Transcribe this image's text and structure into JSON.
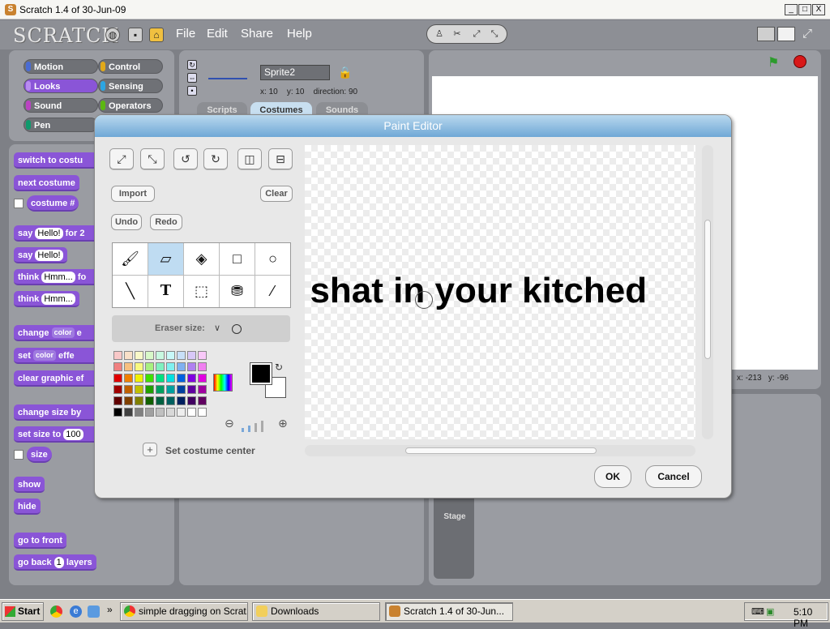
{
  "window": {
    "title": "Scratch 1.4 of 30-Jun-09",
    "app_icon": "scratch-cat-icon",
    "min_label": "_",
    "max_label": "□",
    "close_label": "X"
  },
  "menubar": {
    "logo": "SCRATCH",
    "icons": [
      "globe-icon",
      "save-icon",
      "share-icon"
    ],
    "items": [
      "File",
      "Edit",
      "Share",
      "Help"
    ]
  },
  "categories": {
    "motion": "Motion",
    "looks": "Looks",
    "sound": "Sound",
    "pen": "Pen",
    "control": "Control",
    "sensing": "Sensing",
    "operators": "Operators",
    "variables": ""
  },
  "blocks": {
    "switch_costume": "switch to costu",
    "next_costume": "next costume",
    "costume_num": "costume #",
    "say_for": "say",
    "say_for_val": "Hello!",
    "say_for_tail": "for 2",
    "say": "say",
    "say_val": "Hello!",
    "think_for": "think",
    "think_for_val": "Hmm...",
    "think_for_tail": "fo",
    "think": "think",
    "think_val": "Hmm...",
    "change_effect": "change",
    "change_effect_drop": "color",
    "change_effect_tail": "e",
    "set_effect": "set",
    "set_effect_drop": "color",
    "set_effect_tail": "effe",
    "clear_effects": "clear graphic ef",
    "change_size": "change size by",
    "set_size": "set size to",
    "set_size_val": "100",
    "size": "size",
    "show": "show",
    "hide": "hide",
    "go_front": "go to front",
    "go_back": "go back",
    "go_back_val": "1",
    "go_back_tail": "layers"
  },
  "sprite": {
    "name": "Sprite2",
    "x_label": "x:",
    "x": "10",
    "y_label": "y:",
    "y": "10",
    "dir_label": "direction:",
    "direction": "90"
  },
  "tabs": {
    "scripts": "Scripts",
    "costumes": "Costumes",
    "sounds": "Sounds",
    "active": "Costumes"
  },
  "stage": {
    "coords_x_label": "x:",
    "coords_x": "-213",
    "coords_y_label": "y:",
    "coords_y": "-96",
    "stage_label": "Stage"
  },
  "paint_editor": {
    "title": "Paint Editor",
    "transform_icons": [
      "grow-icon",
      "shrink-icon",
      "rotate-ccw-icon",
      "rotate-cw-icon",
      "flip-horizontal-icon",
      "flip-vertical-icon"
    ],
    "import": "Import",
    "clear": "Clear",
    "undo": "Undo",
    "redo": "Redo",
    "tools": [
      "paintbrush-icon",
      "eraser-icon",
      "fill-icon",
      "rectangle-icon",
      "ellipse-icon",
      "line-icon",
      "text-icon",
      "select-icon",
      "stamp-icon",
      "eyedropper-icon"
    ],
    "selected_tool": "eraser-icon",
    "option_label": "Eraser size:",
    "canvas_text": "i shat in your kitched",
    "set_center": "Set costume center",
    "ok": "OK",
    "cancel": "Cancel",
    "colors": {
      "palette": [
        "#f8c8c8",
        "#f8e0c8",
        "#f8f8c8",
        "#d8f8c8",
        "#c8f8e0",
        "#c8f8f8",
        "#c8e0f8",
        "#d8c8f8",
        "#f8c8f8",
        "#f08080",
        "#f8c080",
        "#f8f880",
        "#a8f080",
        "#80f0c0",
        "#80f0f0",
        "#80b0f0",
        "#b080f0",
        "#f080f0",
        "#e00000",
        "#f08000",
        "#f0f000",
        "#40e000",
        "#00e080",
        "#00e0e0",
        "#0060e0",
        "#8000e0",
        "#e000e0",
        "#a00000",
        "#c06000",
        "#c0c000",
        "#20a000",
        "#00a060",
        "#00a0a0",
        "#0040a0",
        "#6000a0",
        "#a000a0",
        "#600000",
        "#804000",
        "#808000",
        "#106000",
        "#006040",
        "#006060",
        "#002060",
        "#400060",
        "#600060",
        "#000000",
        "#404040",
        "#808080",
        "#a0a0a0",
        "#c0c0c0",
        "#d8d8d8",
        "#eeeeee",
        "#ffffff",
        "#ffffff"
      ],
      "primary": "#000000",
      "secondary": "#ffffff"
    }
  },
  "taskbar": {
    "start": "Start",
    "tasks": [
      "simple dragging on Scrat...",
      "Downloads",
      "Scratch 1.4 of 30-Jun..."
    ],
    "clock": "5:10 PM"
  }
}
